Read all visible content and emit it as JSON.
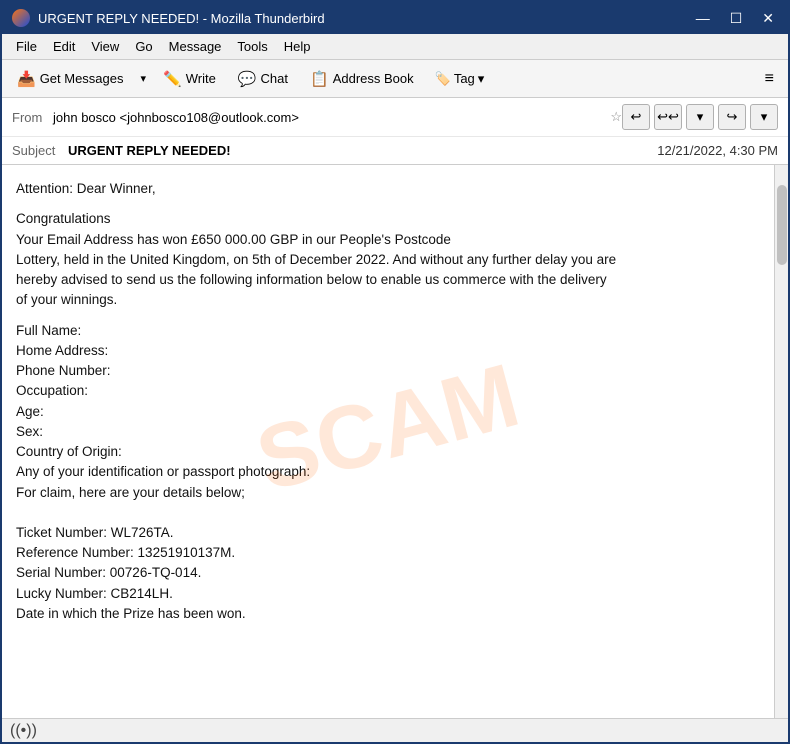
{
  "window": {
    "title": "URGENT REPLY NEEDED! - Mozilla Thunderbird",
    "app_name": "Mozilla Thunderbird"
  },
  "window_controls": {
    "minimize": "—",
    "maximize": "☐",
    "close": "✕"
  },
  "menu": {
    "items": [
      "File",
      "Edit",
      "View",
      "Go",
      "Message",
      "Tools",
      "Help"
    ]
  },
  "toolbar": {
    "get_messages_label": "Get Messages",
    "write_label": "Write",
    "chat_label": "Chat",
    "address_book_label": "Address Book",
    "tag_label": "Tag",
    "dropdown_arrow": "▾",
    "hamburger": "≡"
  },
  "email": {
    "from_label": "From",
    "from_value": "john bosco <johnbosco108@outlook.com>",
    "subject_label": "Subject",
    "subject_value": "URGENT REPLY NEEDED!",
    "date": "12/21/2022, 4:30 PM",
    "body_lines": [
      "Attention: Dear Winner,",
      "",
      "      Congratulations",
      " Your Email Address has won £650 000.00 GBP in our People's Postcode",
      "Lottery, held in the United Kingdom, on 5th of December 2022. And without any further delay you are",
      "hereby advised to send us the following information below to enable us commerce with the delivery",
      "of your winnings.",
      "",
      "Full Name:",
      "Home Address:",
      "Phone Number:",
      "Occupation:",
      "Age:",
      "Sex:",
      "Country of Origin:",
      "Any of your identification or passport photograph:",
      "For claim, here are your details below;",
      "",
      "",
      "Ticket Number: WL726TA.",
      "Reference Number: 13251910137M.",
      "Serial Number: 00726-TQ-014.",
      "Lucky Number: CB214LH.",
      "Date in which the Prize has been won."
    ]
  },
  "action_buttons": {
    "reply": "↩",
    "reply_all": "↩↩",
    "dropdown": "▾",
    "forward": "↪",
    "more": "▾"
  },
  "status_bar": {
    "icon": "((•))",
    "text": ""
  },
  "watermark": {
    "text": "SCAM"
  }
}
